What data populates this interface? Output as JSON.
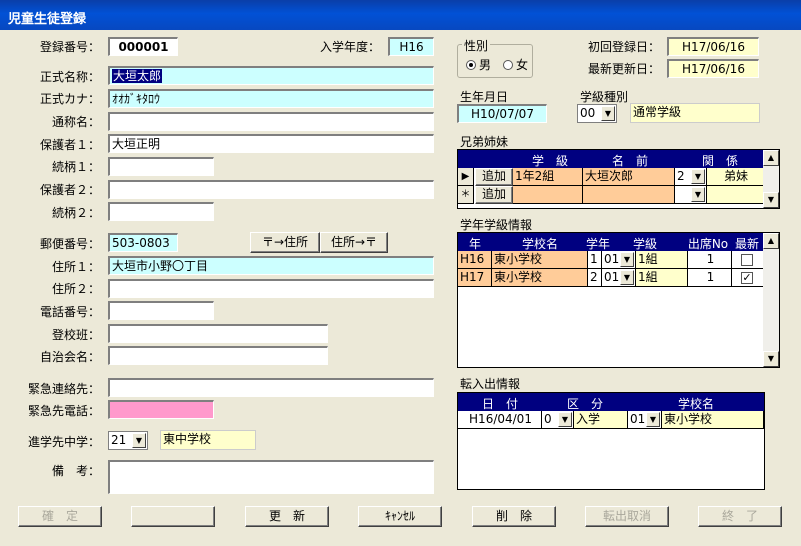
{
  "window": {
    "title": "児童生徒登録"
  },
  "left": {
    "reg_no_label": "登録番号：",
    "reg_no": "000001",
    "entry_year_label": "入学年度：",
    "entry_year": "H16",
    "name_label": "正式名称：",
    "name": "大垣太郎",
    "kana_label": "正式カナ：",
    "kana": "ｵｵｶﾞｷﾀﾛｳ",
    "nickname_label": "通称名：",
    "nickname": "",
    "guardian1_label": "保護者１：",
    "guardian1": "大垣正明",
    "rel1_label": "続柄１：",
    "rel1": "",
    "guardian2_label": "保護者２：",
    "guardian2": "",
    "rel2_label": "続柄２：",
    "rel2": "",
    "postal_label": "郵便番号：",
    "postal": "503-0803",
    "zip_to_addr": "〒→住所",
    "addr_to_zip": "住所→〒",
    "addr1_label": "住所１：",
    "addr1": "大垣市小野〇丁目",
    "addr2_label": "住所２：",
    "addr2": "",
    "phone_label": "電話番号：",
    "phone": "",
    "school_group_label": "登校班：",
    "school_group": "",
    "assoc_label": "自治会名：",
    "assoc": "",
    "emerg_contact_label": "緊急連絡先：",
    "emerg_contact": "",
    "emerg_phone_label": "緊急先電話：",
    "emerg_phone": "",
    "junior_high_label": "進学先中学：",
    "junior_high_code": "21",
    "junior_high_name": "東中学校",
    "remarks_label": "備　考：",
    "remarks": ""
  },
  "right": {
    "gender_label": "性別",
    "male": "男",
    "female": "女",
    "first_reg_label": "初回登録日：",
    "first_reg": "H17/06/16",
    "last_upd_label": "最新更新日：",
    "last_upd": "H17/06/16",
    "birth_label": "生年月日",
    "birth": "H10/07/07",
    "class_type_label": "学級種別",
    "class_type_code": "00",
    "class_type": "通常学級",
    "siblings_label": "兄弟姉妹",
    "siblings_headers": [
      "学　級",
      "名　前",
      "関　係"
    ],
    "siblings_rows": [
      {
        "marker": "▶",
        "btn": "追加",
        "class": "1年2組",
        "name": "大垣次郎",
        "code": "2",
        "rel": "弟妹"
      },
      {
        "marker": "＊",
        "btn": "追加",
        "class": "",
        "name": "",
        "code": "",
        "rel": ""
      }
    ],
    "grade_label": "学年学級情報",
    "grade_headers": [
      "年",
      "学校名",
      "学年",
      "学級",
      "出席No",
      "最新"
    ],
    "grade_rows": [
      {
        "era": "H16",
        "school": "東小学校",
        "grade": "1",
        "cls_code": "01",
        "cls": "1組",
        "att": "1",
        "latest": ""
      },
      {
        "era": "H17",
        "school": "東小学校",
        "grade": "2",
        "cls_code": "01",
        "cls": "1組",
        "att": "1",
        "latest": "✓"
      }
    ],
    "transfer_label": "転入出情報",
    "transfer_headers": [
      "日　付",
      "区　分",
      "学校名"
    ],
    "transfer_rows": [
      {
        "date": "H16/04/01",
        "kind_code": "0",
        "kind": "入学",
        "school_code": "01",
        "school": "東小学校"
      }
    ]
  },
  "buttons": {
    "confirm": "確　定",
    "blank": "",
    "update": "更　新",
    "cancel": "ｷｬﾝｾﾙ",
    "delete": "削　除",
    "undo_transfer": "転出取消",
    "end": "終　了"
  }
}
